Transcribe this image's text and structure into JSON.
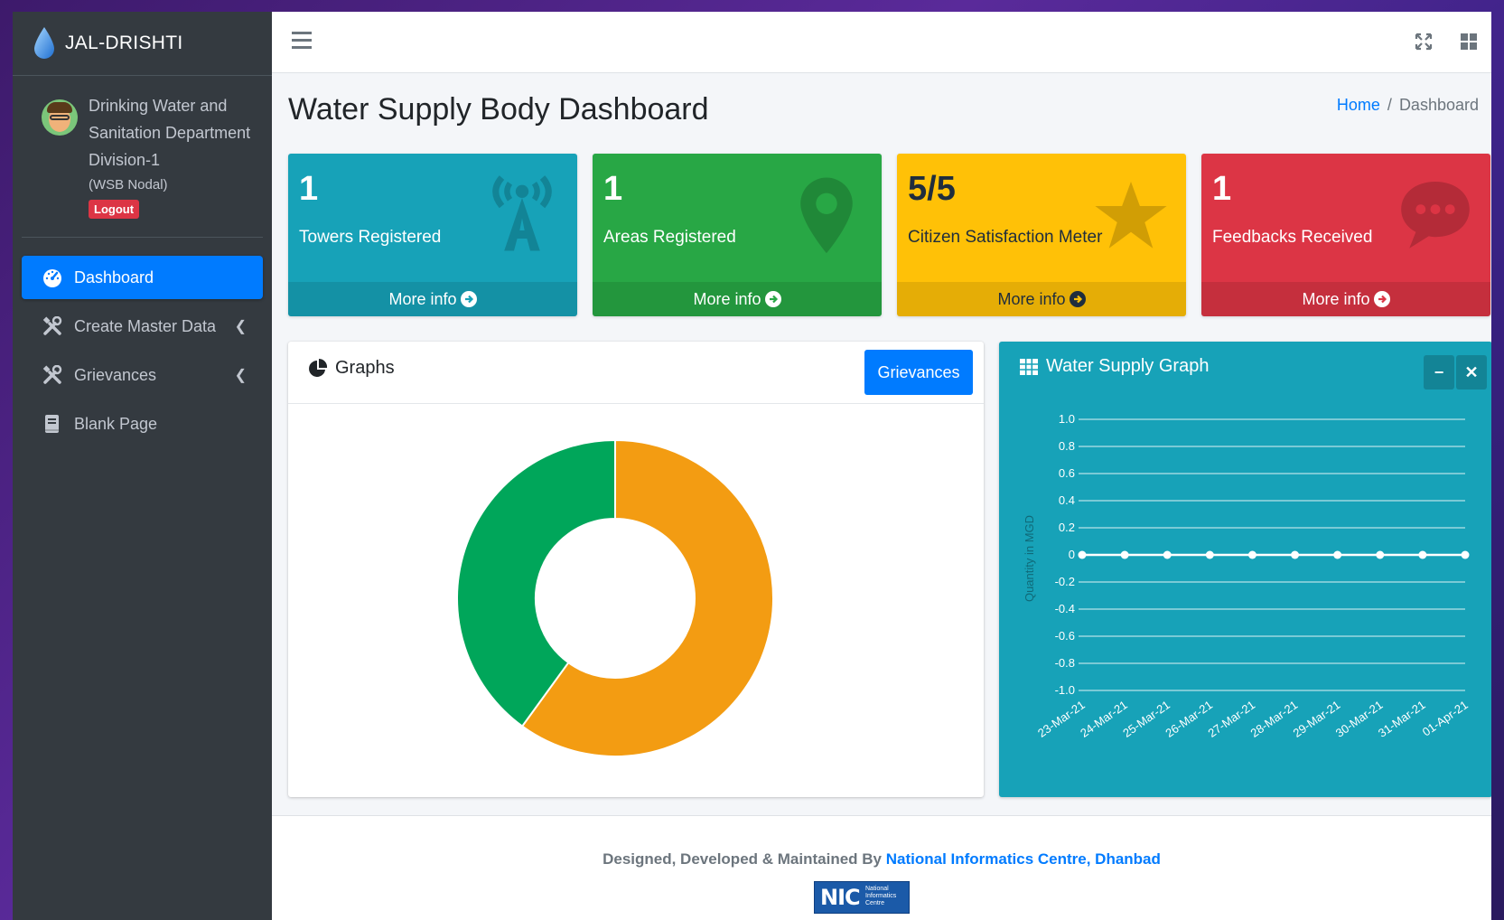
{
  "brand": {
    "name": "JAL-DRISHTI"
  },
  "user": {
    "name": "Drinking Water and Sanitation Department Division-1",
    "role": "(WSB Nodal)",
    "logout_label": "Logout"
  },
  "sidebar": {
    "items": [
      {
        "label": "Dashboard",
        "icon": "tachometer-icon",
        "active": true
      },
      {
        "label": "Create Master Data",
        "icon": "tools-icon",
        "has_submenu": true
      },
      {
        "label": "Grievances",
        "icon": "tools-icon",
        "has_submenu": true
      },
      {
        "label": "Blank Page",
        "icon": "book-icon"
      }
    ]
  },
  "navbar": {
    "icons": [
      "hamburger-icon",
      "fullscreen-icon",
      "grid-icon"
    ]
  },
  "page": {
    "title": "Water Supply Body Dashboard",
    "breadcrumb": {
      "home": "Home",
      "separator": "/",
      "current": "Dashboard"
    }
  },
  "info_boxes": [
    {
      "value": "1",
      "label": "Towers Registered",
      "footer": "More info",
      "color": "#17a2b8",
      "icon": "tower-icon"
    },
    {
      "value": "1",
      "label": "Areas Registered",
      "footer": "More info",
      "color": "#28a745",
      "icon": "map-marker-icon"
    },
    {
      "value": "5/5",
      "label": "Citizen Satisfaction Meter",
      "footer": "More info",
      "color": "#ffc107",
      "icon": "star-icon"
    },
    {
      "value": "1",
      "label": "Feedbacks Received",
      "footer": "More info",
      "color": "#dc3545",
      "icon": "comment-icon"
    }
  ],
  "graphs_card": {
    "title": "Graphs",
    "button_label": "Grievances"
  },
  "water_card": {
    "title": "Water Supply Graph",
    "collapse_label": "−",
    "close_label": "✕"
  },
  "footer": {
    "text": "Designed, Developed & Maintained By",
    "link": "National Informatics Centre, Dhanbad",
    "logo_text": "NIC",
    "logo_sub": [
      "National",
      "Informatics",
      "Centre"
    ]
  },
  "chart_data": [
    {
      "type": "pie",
      "variant": "doughnut",
      "slices": [
        {
          "value": 60,
          "color": "#f39c12"
        },
        {
          "value": 40,
          "color": "#00a65a"
        }
      ]
    },
    {
      "type": "line",
      "ylabel": "Quantity in MGD",
      "ylim": [
        -1.0,
        1.0
      ],
      "yticks": [
        "1.0",
        "0.8",
        "0.6",
        "0.4",
        "0.2",
        "0",
        "-0.2",
        "-0.4",
        "-0.6",
        "-0.8",
        "-1.0"
      ],
      "categories": [
        "23-Mar-21",
        "24-Mar-21",
        "25-Mar-21",
        "26-Mar-21",
        "27-Mar-21",
        "28-Mar-21",
        "29-Mar-21",
        "30-Mar-21",
        "31-Mar-21",
        "01-Apr-21"
      ],
      "values": [
        0,
        0,
        0,
        0,
        0,
        0,
        0,
        0,
        0,
        0
      ],
      "grid": true,
      "line_color": "#ffffff"
    }
  ]
}
